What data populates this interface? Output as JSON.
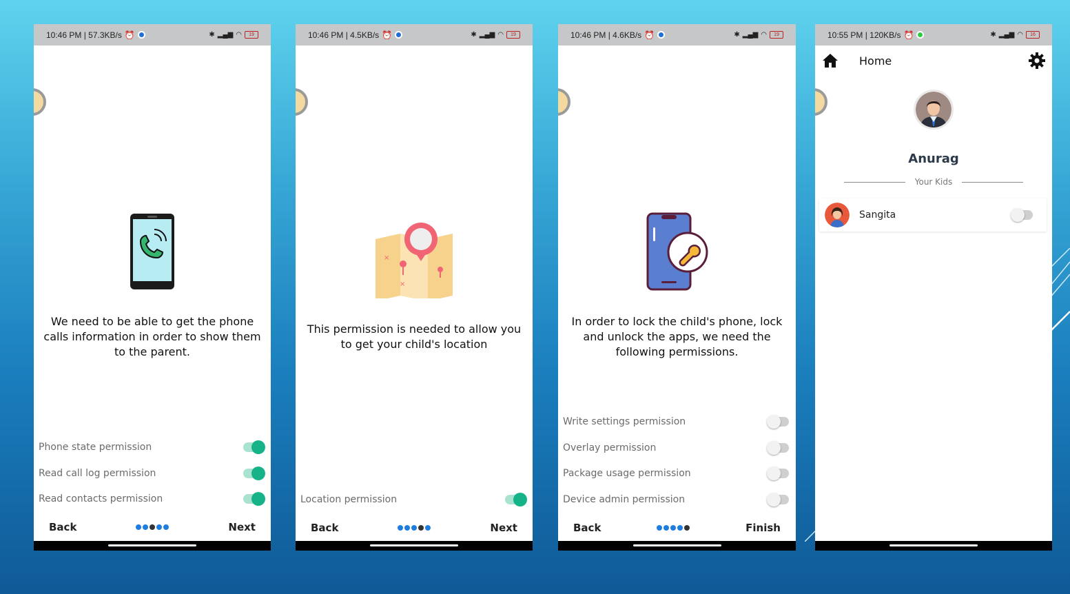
{
  "screens": [
    {
      "status": {
        "time_speed": "10:46 PM | 57.3KB/s",
        "battery": "19"
      },
      "illustration": "phone-call-icon",
      "message": "We need to be able to get the phone calls information in order to show them to the parent.",
      "permissions": [
        {
          "label": "Phone state permission",
          "enabled": true
        },
        {
          "label": "Read call log permission",
          "enabled": true
        },
        {
          "label": "Read contacts permission",
          "enabled": true
        }
      ],
      "nav": {
        "back": "Back",
        "next": "Next",
        "step": 3,
        "total": 5
      }
    },
    {
      "status": {
        "time_speed": "10:46 PM | 4.5KB/s",
        "battery": "19"
      },
      "illustration": "map-location-icon",
      "message": "This permission is needed to allow you to get your child's location",
      "permissions": [
        {
          "label": "Location permission",
          "enabled": true
        }
      ],
      "nav": {
        "back": "Back",
        "next": "Next",
        "step": 4,
        "total": 5
      }
    },
    {
      "status": {
        "time_speed": "10:46 PM | 4.6KB/s",
        "battery": "19"
      },
      "illustration": "phone-wrench-icon",
      "message": "In order to lock the child's phone, lock and unlock the apps, we need the following permissions.",
      "permissions": [
        {
          "label": "Write settings permission",
          "enabled": false
        },
        {
          "label": "Overlay permission",
          "enabled": false
        },
        {
          "label": "Package usage permission",
          "enabled": false
        },
        {
          "label": "Device admin permission",
          "enabled": false
        }
      ],
      "nav": {
        "back": "Back",
        "next": "Finish",
        "step": 5,
        "total": 5
      }
    },
    {
      "status": {
        "time_speed": "10:55 PM | 120KB/s",
        "battery": "16"
      },
      "topbar": {
        "title": "Home",
        "home_icon": "home-icon",
        "settings_icon": "gear-icon"
      },
      "profile": {
        "name": "Anurag"
      },
      "kids_label": "Your Kids",
      "kids": [
        {
          "name": "Sangita",
          "enabled": false
        }
      ]
    }
  ],
  "colors": {
    "toggle_on": "#16b388",
    "dot_active": "#1e7de0",
    "dot_current": "#333333"
  }
}
